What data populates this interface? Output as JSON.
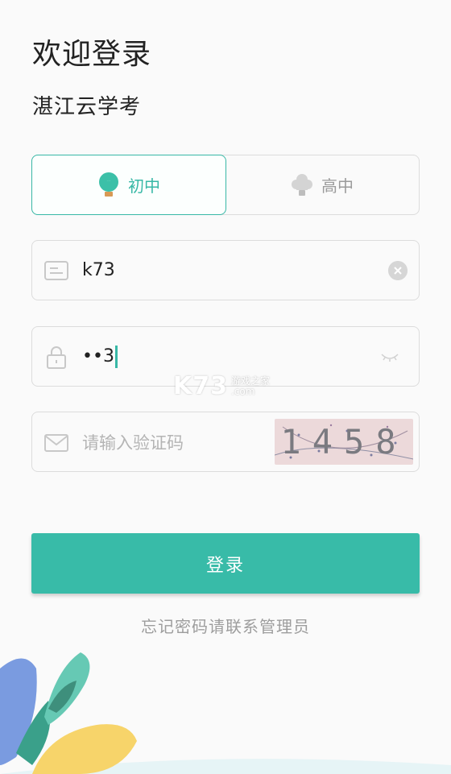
{
  "header": {
    "title": "欢迎登录",
    "subtitle": "湛江云学考"
  },
  "tabs": [
    {
      "label": "初中",
      "icon": "lightbulb-icon",
      "active": true
    },
    {
      "label": "高中",
      "icon": "cloud-bulb-icon",
      "active": false
    }
  ],
  "username": {
    "value": "k73",
    "icon": "id-card-icon"
  },
  "password": {
    "value": "••3",
    "icon": "lock-icon"
  },
  "captcha": {
    "placeholder": "请输入验证码",
    "code": "1458",
    "icon": "mail-icon"
  },
  "login_button": {
    "label": "登录"
  },
  "forgot_text": "忘记密码请联系管理员",
  "watermark": {
    "main": "K73",
    "side_top": "游戏之家",
    "side_bottom": ".com"
  },
  "colors": {
    "accent": "#38bba8",
    "border": "#dcdcdc",
    "placeholder": "#b4b4b4"
  }
}
